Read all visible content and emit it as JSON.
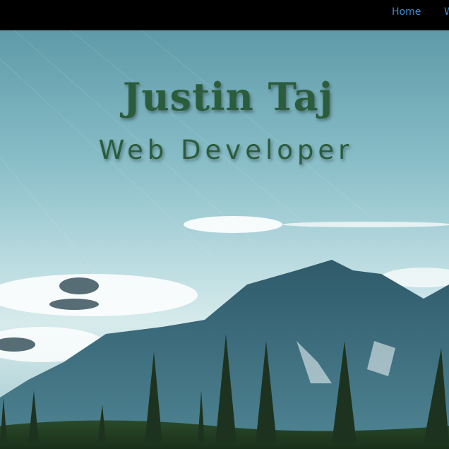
{
  "nav": {
    "items": [
      {
        "label": "Home"
      },
      {
        "label": "W"
      }
    ],
    "link_color": "#3d8fd6"
  },
  "hero": {
    "title": "Justin Taj",
    "subtitle": "Web Developer",
    "text_color": "#2b5d3c",
    "background": "mountain-landscape-image"
  }
}
